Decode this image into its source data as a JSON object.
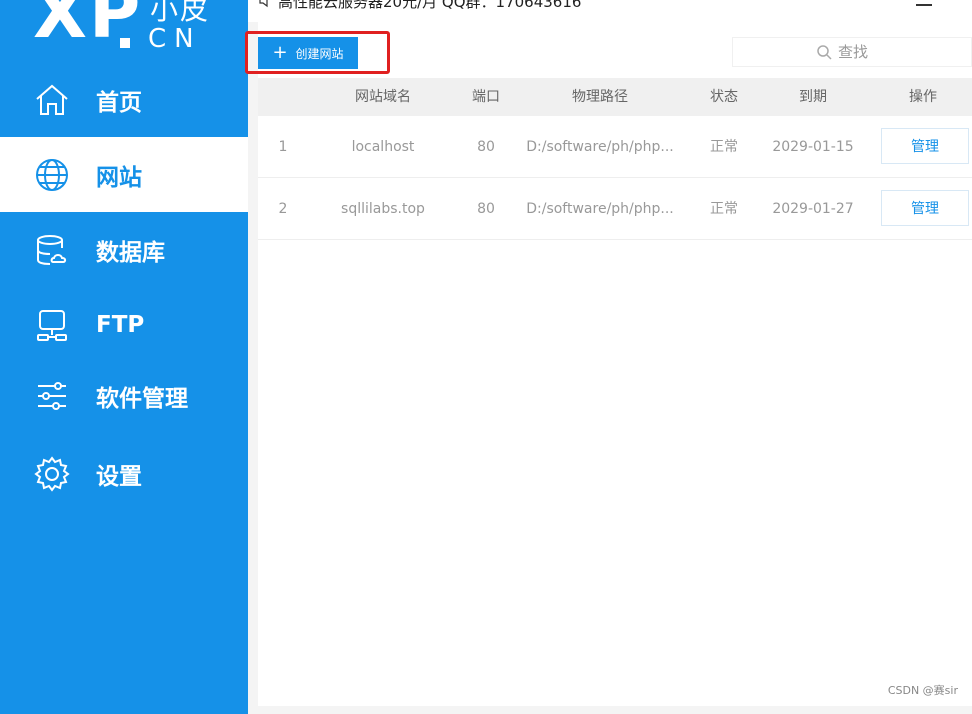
{
  "app": {
    "logo_main": "XP",
    "logo_small": "小皮",
    "logo_cn": "CN"
  },
  "topbar": {
    "ad_text": "高性能云服务器20元/月  QQ群：170643616"
  },
  "sidebar": {
    "items": [
      {
        "label": "首页",
        "icon": "home-icon"
      },
      {
        "label": "网站",
        "icon": "globe-icon",
        "active": true
      },
      {
        "label": "数据库",
        "icon": "database-icon"
      },
      {
        "label": "FTP",
        "icon": "ftp-icon"
      },
      {
        "label": "软件管理",
        "icon": "sliders-icon"
      },
      {
        "label": "设置",
        "icon": "gear-icon"
      }
    ]
  },
  "toolbar": {
    "create_label": "创建网站",
    "search_placeholder": "查找"
  },
  "table": {
    "headers": {
      "domain": "网站域名",
      "port": "端口",
      "path": "物理路径",
      "status": "状态",
      "expire": "到期",
      "action": "操作"
    },
    "rows": [
      {
        "num": "1",
        "domain": "localhost",
        "port": "80",
        "path": "D:/software/ph/php...",
        "status": "正常",
        "expire": "2029-01-15",
        "action": "管理"
      },
      {
        "num": "2",
        "domain": "sqllilabs.top",
        "port": "80",
        "path": "D:/software/ph/php...",
        "status": "正常",
        "expire": "2029-01-27",
        "action": "管理"
      }
    ]
  },
  "watermark": "CSDN @赛sir",
  "colors": {
    "brand": "#1591e8",
    "highlight": "#e02020"
  }
}
